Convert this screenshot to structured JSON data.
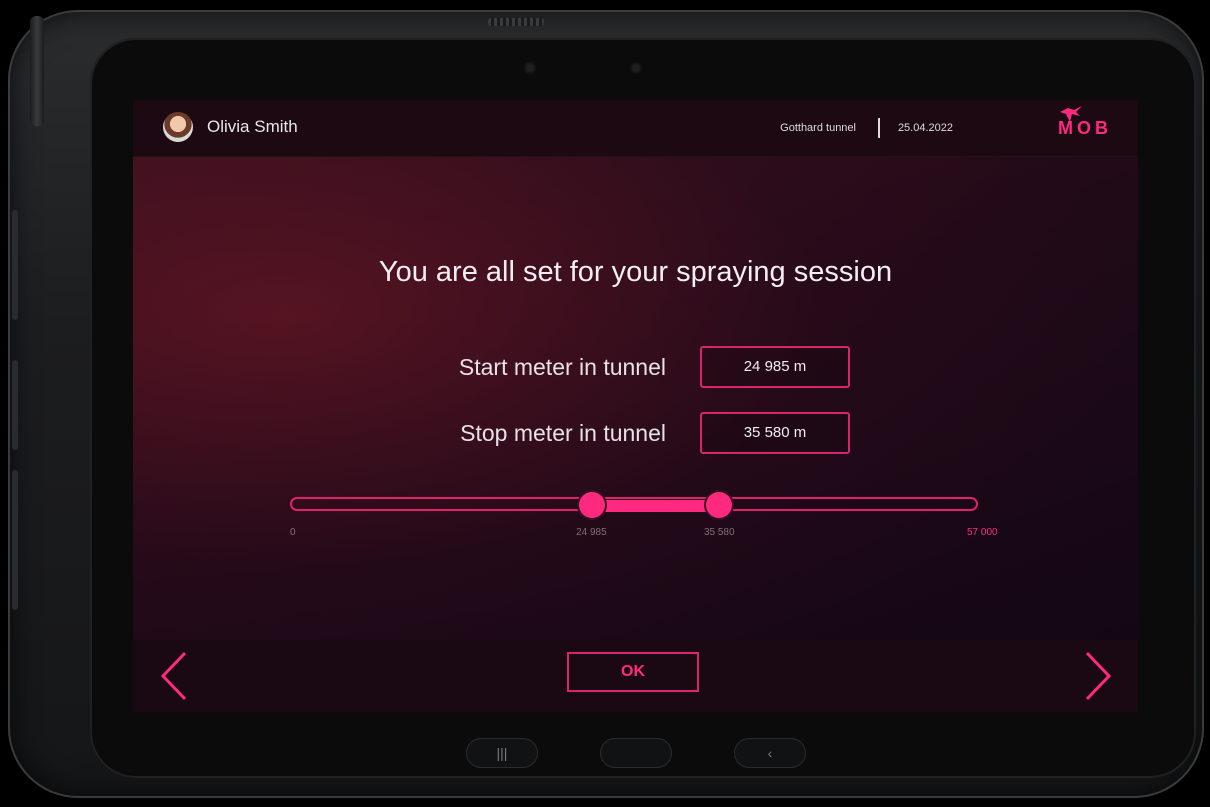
{
  "header": {
    "user_name": "Olivia Smith",
    "location": "Gotthard tunnel",
    "date": "25.04.2022",
    "brand": "MOB   "
  },
  "main": {
    "title": "You are all set for your spraying session",
    "start_label": "Start meter in tunnel",
    "start_value": "24 985 m",
    "stop_label": "Stop meter in tunnel",
    "stop_value": "35 580 m"
  },
  "range_slider": {
    "min": 0,
    "max": 57000,
    "start": 24985,
    "stop": 35580,
    "min_label": "0",
    "start_label": "24 985",
    "stop_label": "35 580",
    "max_label": "57 000"
  },
  "footer": {
    "ok_label": "OK"
  },
  "icons": {
    "back": "chevron-left-icon",
    "forward": "chevron-right-icon",
    "recents": "recents-icon",
    "home": "home-icon",
    "system_back": "back-icon"
  },
  "colors": {
    "accent": "#ff2a7f",
    "topbar": "#1c0912",
    "text": "#f2eef3"
  }
}
